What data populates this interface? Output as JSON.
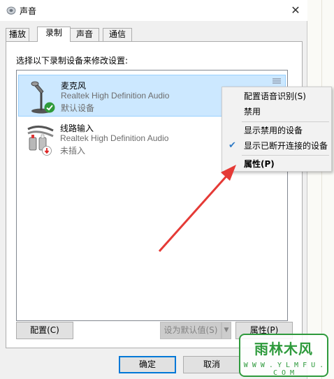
{
  "window": {
    "title": "声音",
    "close_icon": "close-icon"
  },
  "tabs": [
    {
      "label": "播放",
      "active": false
    },
    {
      "label": "录制",
      "active": true
    },
    {
      "label": "声音",
      "active": false
    },
    {
      "label": "通信",
      "active": false
    }
  ],
  "instruction": "选择以下录制设备来修改设置:",
  "devices": [
    {
      "name": "麦克风",
      "driver": "Realtek High Definition Audio",
      "status": "默认设备",
      "icon": "microphone-icon",
      "badge": "green-check-icon",
      "selected": true
    },
    {
      "name": "线路输入",
      "driver": "Realtek High Definition Audio",
      "status": "未插入",
      "icon": "line-in-cable-icon",
      "badge": "red-down-arrow-icon",
      "selected": false
    }
  ],
  "context_menu": {
    "items": [
      {
        "label": "配置语音识别(S)",
        "checked": false,
        "bold": false
      },
      {
        "label": "禁用",
        "checked": false,
        "bold": false
      },
      {
        "label": "显示禁用的设备",
        "checked": false,
        "bold": false
      },
      {
        "label": "显示已断开连接的设备",
        "checked": true,
        "bold": false
      },
      {
        "label": "属性(P)",
        "checked": false,
        "bold": true
      }
    ]
  },
  "buttons": {
    "configure": "配置(C)",
    "set_default": "设为默认值(S)",
    "properties": "属性(P)",
    "ok": "确定",
    "cancel": "取消"
  },
  "watermark": {
    "text": "雨林木风",
    "url": "W W W . Y L M F U . C O M"
  },
  "colors": {
    "selection": "#cce8ff",
    "accent": "#0078d7",
    "arrow": "#e53a36",
    "watermark": "#2e9a3c"
  }
}
